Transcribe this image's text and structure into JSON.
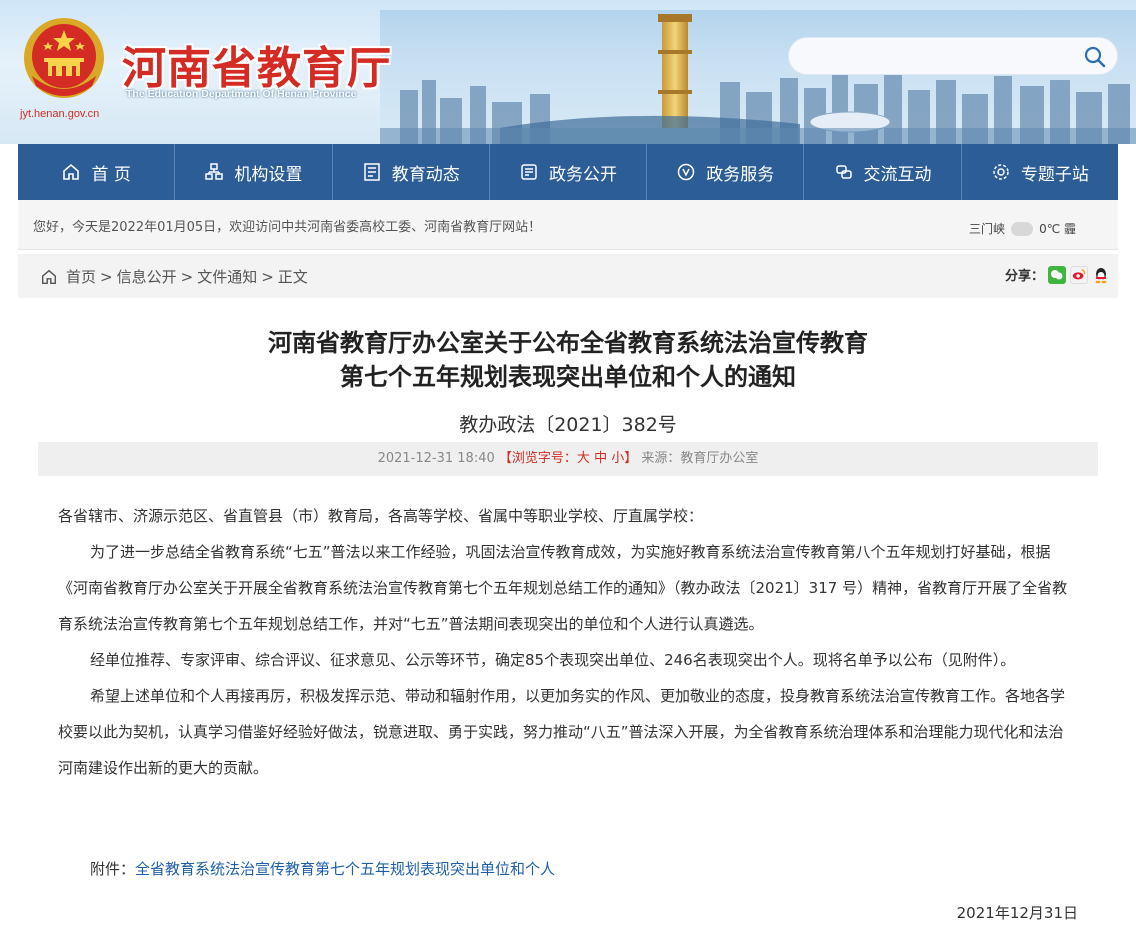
{
  "header": {
    "title": "河南省教育厅",
    "subtitle": "The Education Department Of Henan Province",
    "domain": "jyt.henan.gov.cn",
    "search": {
      "placeholder": "",
      "value": ""
    }
  },
  "nav": {
    "items": [
      {
        "label": "首 页",
        "icon": "home-icon"
      },
      {
        "label": "机构设置",
        "icon": "org-chart-icon"
      },
      {
        "label": "教育动态",
        "icon": "news-icon"
      },
      {
        "label": "政务公开",
        "icon": "document-icon"
      },
      {
        "label": "政务服务",
        "icon": "service-icon"
      },
      {
        "label": "交流互动",
        "icon": "interaction-icon"
      },
      {
        "label": "专题子站",
        "icon": "gear-icon"
      }
    ],
    "color": "#2c5d96"
  },
  "welcome": {
    "text": "您好，今天是2022年01月05日，欢迎访问中共河南省委高校工委、河南省教育厅网站！",
    "weather_city": "三门峡",
    "weather_temp": "0℃ 霾"
  },
  "breadcrumb": {
    "items": [
      "首页",
      "信息公开",
      "文件通知",
      "正文"
    ],
    "share_label": "分享："
  },
  "article": {
    "title_line1": "河南省教育厅办公室关于公布全省教育系统法治宣传教育",
    "title_line2": "第七个五年规划表现突出单位和个人的通知",
    "doc_number": "教办政法〔2021〕382号",
    "meta_date": "2021-12-31 18:40",
    "meta_font_prefix": "【浏览字号：",
    "meta_font_large": "大",
    "meta_font_medium": "中",
    "meta_font_small": "小",
    "meta_font_suffix": "】",
    "meta_source": "来源：教育厅办公室",
    "salutation": "各省辖市、济源示范区、省直管县（市）教育局，各高等学校、省属中等职业学校、厅直属学校：",
    "para1": "为了进一步总结全省教育系统“七五”普法以来工作经验，巩固法治宣传教育成效，为实施好教育系统法治宣传教育第八个五年规划打好基础，根据《河南省教育厅办公室关于开展全省教育系统法治宣传教育第七个五年规划总结工作的通知》（教办政法〔2021〕317 号）精神，省教育厅开展了全省教育系统法治宣传教育第七个五年规划总结工作，并对“七五”普法期间表现突出的单位和个人进行认真遴选。",
    "para2": "经单位推荐、专家评审、综合评议、征求意见、公示等环节，确定85个表现突出单位、246名表现突出个人。现将名单予以公布（见附件）。",
    "para3": "希望上述单位和个人再接再厉，积极发挥示范、带动和辐射作用，以更加务实的作风、更加敬业的态度，投身教育系统法治宣传教育工作。各地各学校要以此为契机，认真学习借鉴好经验好做法，锐意进取、勇于实践，努力推动“八五”普法深入开展，为全省教育系统治理体系和治理能力现代化和法治河南建设作出新的更大的贡献。",
    "attachment_label": "附件：",
    "attachment_link": "全省教育系统法治宣传教育第七个五年规划表现突出单位和个人",
    "sign_date": "2021年12月31日"
  }
}
